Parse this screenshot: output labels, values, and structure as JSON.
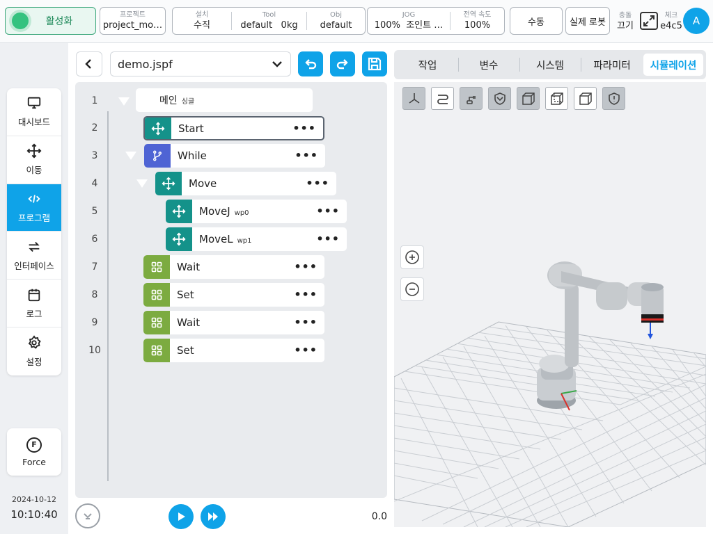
{
  "topbar": {
    "power_label": "활성화",
    "project_caption": "프로젝트",
    "project_value": "project_mo…",
    "install_caption": "설치",
    "install_value": "수직",
    "tool_caption": "Tool",
    "tool_name": "default",
    "tool_payload": "0kg",
    "obj_caption": "Obj",
    "obj_value": "default",
    "jog_caption": "JOG",
    "jog_speed": "100%",
    "jog_mode": "조인트 …",
    "global_speed_caption": "전역 속도",
    "global_speed_value": "100%",
    "manual_label": "수동",
    "real_robot_label": "실제 로봇",
    "collision_caption": "충돌",
    "collision_value": "끄기",
    "check_caption": "체크",
    "check_value": "e4c5",
    "avatar_initial": "A"
  },
  "nav": {
    "items": [
      {
        "label": "대시보드",
        "icon": "monitor-icon"
      },
      {
        "label": "이동",
        "icon": "move-icon"
      },
      {
        "label": "프로그램",
        "icon": "code-icon",
        "active": true
      },
      {
        "label": "인터페이스",
        "icon": "swap-icon"
      },
      {
        "label": "로그",
        "icon": "calendar-icon"
      },
      {
        "label": "설정",
        "icon": "gear-icon"
      }
    ],
    "force_label": "Force",
    "force_letter": "F",
    "date": "2024-10-12",
    "time": "10:10:40"
  },
  "program": {
    "file_name": "demo.jspf",
    "speed_value": "0.0",
    "lines": [
      {
        "num": "1",
        "label": "메인",
        "sub": "싱글"
      },
      {
        "num": "2",
        "label": "Start"
      },
      {
        "num": "3",
        "label": "While"
      },
      {
        "num": "4",
        "label": "Move"
      },
      {
        "num": "5",
        "label": "MoveJ",
        "sub": "wp0"
      },
      {
        "num": "6",
        "label": "MoveL",
        "sub": "wp1"
      },
      {
        "num": "7",
        "label": "Wait"
      },
      {
        "num": "8",
        "label": "Set"
      },
      {
        "num": "9",
        "label": "Wait"
      },
      {
        "num": "10",
        "label": "Set"
      }
    ],
    "more_glyph": "•••"
  },
  "tabs": [
    "작업",
    "변수",
    "시스템",
    "파라미터",
    "시뮬레이션"
  ],
  "active_tab": "시뮬레이션",
  "colors": {
    "accent": "#0fa3e8",
    "power_green": "#34c27f",
    "move_teal": "#14928a",
    "while_blue": "#4f64d4",
    "wait_green": "#7cab40"
  }
}
